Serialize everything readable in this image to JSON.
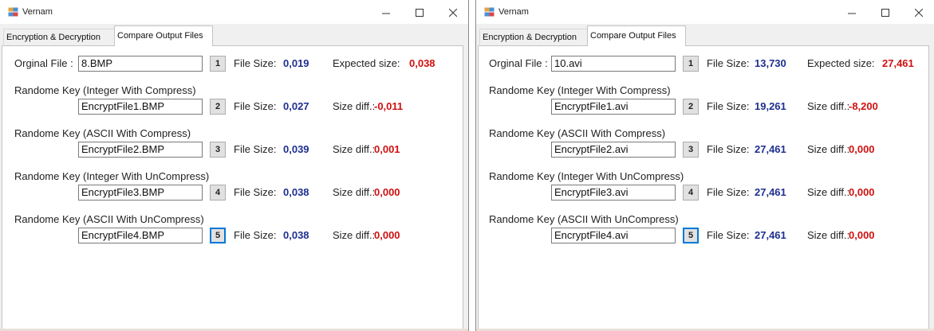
{
  "windows": [
    {
      "title": "Vernam",
      "tabs": [
        "Encryption & Decryption",
        "Compare Output Files"
      ],
      "active_tab": 1,
      "original_label": "Orginal File :",
      "original_file": "8.BMP",
      "orig_button": "1",
      "file_size_label": "File Size:",
      "original_size": "0,019",
      "expected_label": "Expected size:",
      "expected_size": "0,038",
      "rows": [
        {
          "label": "Randome Key (Integer With Compress)",
          "file": "EncryptFile1.BMP",
          "button": "2",
          "size_label": "File Size:",
          "size": "0,027",
          "diff_label": "Size diff.:",
          "diff": "-0,011"
        },
        {
          "label": "Randome Key (ASCII With Compress)",
          "file": "EncryptFile2.BMP",
          "button": "3",
          "size_label": "File Size:",
          "size": "0,039",
          "diff_label": "Size diff.:",
          "diff": "0,001"
        },
        {
          "label": "Randome Key (Integer With UnCompress)",
          "file": "EncryptFile3.BMP",
          "button": "4",
          "size_label": "File Size:",
          "size": "0,038",
          "diff_label": "Size diff.:",
          "diff": "0,000"
        },
        {
          "label": "Randome Key (ASCII With UnCompress)",
          "file": "EncryptFile4.BMP",
          "button": "5",
          "size_label": "File Size:",
          "size": "0,038",
          "diff_label": "Size diff.:",
          "diff": "0,000"
        }
      ]
    },
    {
      "title": "Vernam",
      "tabs": [
        "Encryption & Decryption",
        "Compare Output Files"
      ],
      "active_tab": 1,
      "original_label": "Orginal File :",
      "original_file": "10.avi",
      "orig_button": "1",
      "file_size_label": "File Size:",
      "original_size": "13,730",
      "expected_label": "Expected size:",
      "expected_size": "27,461",
      "rows": [
        {
          "label": "Randome Key (Integer With Compress)",
          "file": "EncryptFile1.avi",
          "button": "2",
          "size_label": "File Size:",
          "size": "19,261",
          "diff_label": "Size diff.:",
          "diff": "-8,200"
        },
        {
          "label": "Randome Key (ASCII With Compress)",
          "file": "EncryptFile2.avi",
          "button": "3",
          "size_label": "File Size:",
          "size": "27,461",
          "diff_label": "Size diff.:",
          "diff": "0,000"
        },
        {
          "label": "Randome Key (Integer With UnCompress)",
          "file": "EncryptFile3.avi",
          "button": "4",
          "size_label": "File Size:",
          "size": "27,461",
          "diff_label": "Size diff.:",
          "diff": "0,000"
        },
        {
          "label": "Randome Key (ASCII With UnCompress)",
          "file": "EncryptFile4.avi",
          "button": "5",
          "size_label": "File Size:",
          "size": "27,461",
          "diff_label": "Size diff.:",
          "diff": "0,000"
        }
      ]
    }
  ]
}
